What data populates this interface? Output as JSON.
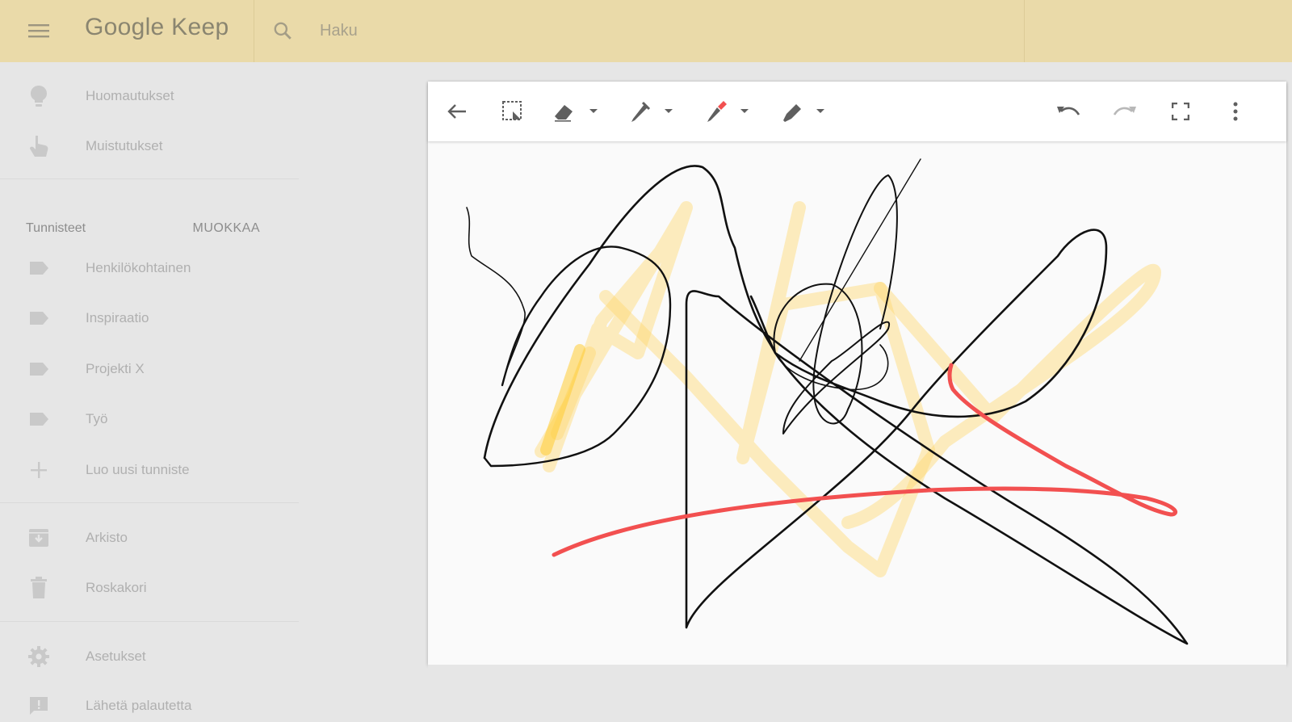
{
  "app": {
    "brand": "Google Keep"
  },
  "search": {
    "placeholder": "Haku"
  },
  "sidebar": {
    "items": [
      {
        "label": "Huomautukset",
        "icon": "lightbulb-icon"
      },
      {
        "label": "Muistutukset",
        "icon": "reminder-hand-icon"
      }
    ],
    "labels_header": "Tunnisteet",
    "labels_edit": "MUOKKAA",
    "labels": [
      {
        "label": "Henkilökohtainen",
        "icon": "label-icon"
      },
      {
        "label": "Inspiraatio",
        "icon": "label-icon"
      },
      {
        "label": "Projekti X",
        "icon": "label-icon"
      },
      {
        "label": "Työ",
        "icon": "label-icon"
      }
    ],
    "create_label": "Luo uusi tunniste",
    "archive": "Arkisto",
    "trash": "Roskakori",
    "settings": "Asetukset",
    "feedback": "Lähetä palautetta"
  },
  "colors": {
    "topbar": "#eadaa9",
    "pen_red": "#f25050",
    "highlighter": "#ffd76a",
    "ink": "#111111"
  }
}
